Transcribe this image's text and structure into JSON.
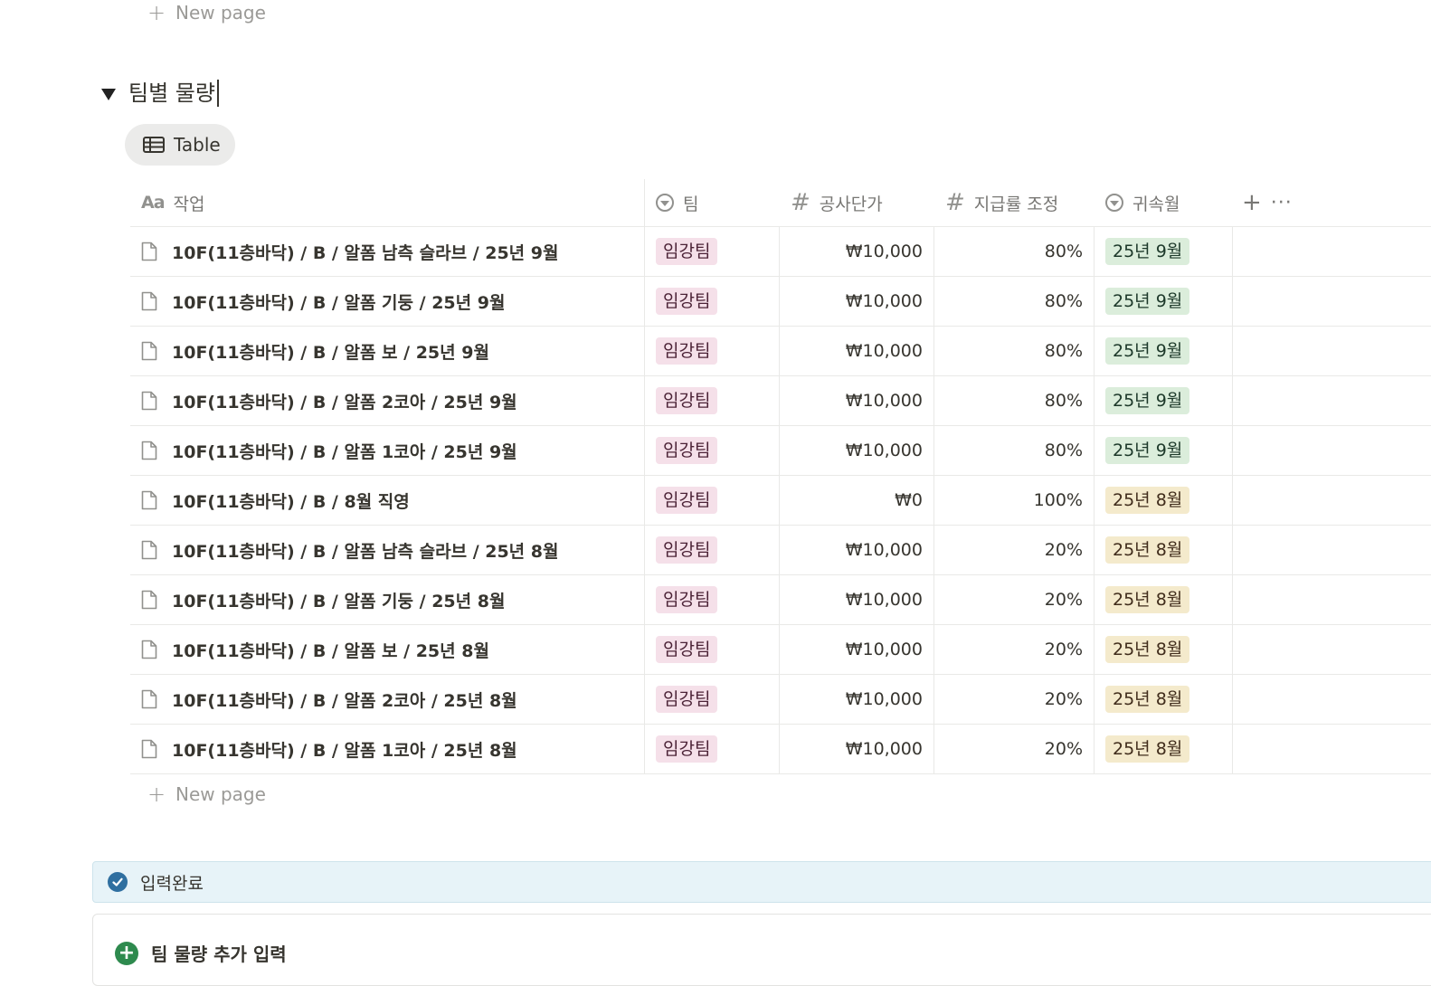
{
  "new_page_label": "New page",
  "group": {
    "title": "팀별 물량"
  },
  "view": {
    "label": "Table"
  },
  "columns": {
    "name": "작업",
    "team": "팀",
    "cost": "공사단가",
    "rate": "지급률 조정",
    "month": "귀속월"
  },
  "rows": [
    {
      "name": "10F(11층바닥) / B / 알폼 남측 슬라브 / 25년 9월",
      "team": "임강팀",
      "cost": "₩10,000",
      "rate": "80%",
      "month": "25년 9월",
      "month_color": "green"
    },
    {
      "name": "10F(11층바닥) / B / 알폼 기둥 / 25년 9월",
      "team": "임강팀",
      "cost": "₩10,000",
      "rate": "80%",
      "month": "25년 9월",
      "month_color": "green"
    },
    {
      "name": "10F(11층바닥) / B / 알폼 보 / 25년 9월",
      "team": "임강팀",
      "cost": "₩10,000",
      "rate": "80%",
      "month": "25년 9월",
      "month_color": "green"
    },
    {
      "name": "10F(11층바닥) / B / 알폼 2코아 / 25년 9월",
      "team": "임강팀",
      "cost": "₩10,000",
      "rate": "80%",
      "month": "25년 9월",
      "month_color": "green"
    },
    {
      "name": "10F(11층바닥) / B / 알폼 1코아 / 25년 9월",
      "team": "임강팀",
      "cost": "₩10,000",
      "rate": "80%",
      "month": "25년 9월",
      "month_color": "green"
    },
    {
      "name": "10F(11층바닥) / B / 8월 직영",
      "team": "임강팀",
      "cost": "₩0",
      "rate": "100%",
      "month": "25년 8월",
      "month_color": "yellow"
    },
    {
      "name": "10F(11층바닥) / B / 알폼 남측 슬라브 / 25년 8월",
      "team": "임강팀",
      "cost": "₩10,000",
      "rate": "20%",
      "month": "25년 8월",
      "month_color": "yellow"
    },
    {
      "name": "10F(11층바닥) / B / 알폼 기둥 / 25년 8월",
      "team": "임강팀",
      "cost": "₩10,000",
      "rate": "20%",
      "month": "25년 8월",
      "month_color": "yellow"
    },
    {
      "name": "10F(11층바닥) / B / 알폼 보 / 25년 8월",
      "team": "임강팀",
      "cost": "₩10,000",
      "rate": "20%",
      "month": "25년 8월",
      "month_color": "yellow"
    },
    {
      "name": "10F(11층바닥) / B / 알폼 2코아 / 25년 8월",
      "team": "임강팀",
      "cost": "₩10,000",
      "rate": "20%",
      "month": "25년 8월",
      "month_color": "yellow"
    },
    {
      "name": "10F(11층바닥) / B / 알폼 1코아 / 25년 8월",
      "team": "임강팀",
      "cost": "₩10,000",
      "rate": "20%",
      "month": "25년 8월",
      "month_color": "yellow"
    }
  ],
  "callout": {
    "label": "입력완료"
  },
  "add_block": {
    "label": "팀 물량 추가 입력"
  }
}
